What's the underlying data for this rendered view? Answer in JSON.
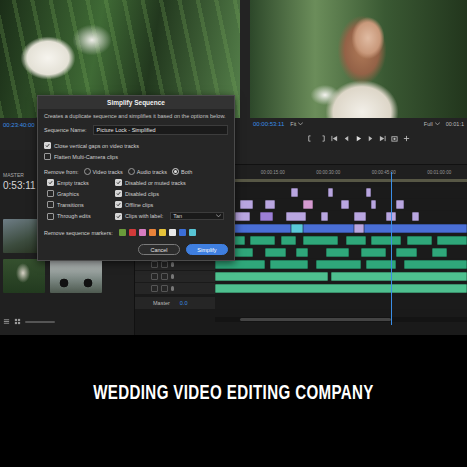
{
  "source_monitor": {
    "timecode": "00:23:40:00"
  },
  "program_monitor": {
    "timecode": "00:00:53:11",
    "fit": "Fit",
    "quality": "Full",
    "duration": "00:01:1"
  },
  "project_panel": {
    "label": "MASTER",
    "timecode": "0:53:11"
  },
  "timeline": {
    "ruler": [
      "00:00:15:00",
      "00:00:30:00",
      "00:00:45:00",
      "00:01:00:00"
    ],
    "playhead": {
      "level": 0.7
    },
    "tracks": [
      {
        "kind": "video",
        "clips": [
          {
            "start": 30,
            "length": 3,
            "color": "#b9a6e0"
          },
          {
            "start": 45,
            "length": 2,
            "color": "#b9a6e0"
          },
          {
            "start": 60,
            "length": 2,
            "color": "#b9a6e0"
          }
        ]
      },
      {
        "kind": "video",
        "clips": [
          {
            "start": 10,
            "length": 5,
            "color": "#b9a6e0"
          },
          {
            "start": 20,
            "length": 4,
            "color": "#b9a6e0"
          },
          {
            "start": 35,
            "length": 4,
            "color": "#d59ad0"
          },
          {
            "start": 50,
            "length": 3,
            "color": "#b9a6e0"
          },
          {
            "start": 62,
            "length": 2,
            "color": "#b9a6e0"
          },
          {
            "start": 72,
            "length": 3,
            "color": "#b9a6e0"
          }
        ]
      },
      {
        "kind": "video",
        "clips": [
          {
            "start": 8,
            "length": 6,
            "color": "#b9a6e0"
          },
          {
            "start": 18,
            "length": 5,
            "color": "#9c7fd6"
          },
          {
            "start": 28,
            "length": 8,
            "color": "#b9a6e0"
          },
          {
            "start": 42,
            "length": 3,
            "color": "#b9a6e0"
          },
          {
            "start": 55,
            "length": 5,
            "color": "#b9a6e0"
          },
          {
            "start": 68,
            "length": 4,
            "color": "#b9a6e0"
          },
          {
            "start": 78,
            "length": 3,
            "color": "#b9a6e0"
          }
        ]
      },
      {
        "kind": "video",
        "clips": [
          {
            "start": 0,
            "length": 30,
            "color": "#4a6fd6"
          },
          {
            "start": 30,
            "length": 5,
            "color": "#5ac8d8"
          },
          {
            "start": 35,
            "length": 20,
            "color": "#4a6fd6"
          },
          {
            "start": 55,
            "length": 4,
            "color": "#b9a6e0"
          },
          {
            "start": 59,
            "length": 41,
            "color": "#4a6fd6"
          }
        ]
      },
      {
        "kind": "audio",
        "clips": [
          {
            "start": 0,
            "length": 12,
            "color": "#2fa77a"
          },
          {
            "start": 14,
            "length": 10,
            "color": "#2fa77a"
          },
          {
            "start": 26,
            "length": 6,
            "color": "#2fa77a"
          },
          {
            "start": 35,
            "length": 14,
            "color": "#2fa77a"
          },
          {
            "start": 52,
            "length": 8,
            "color": "#2fa77a"
          },
          {
            "start": 62,
            "length": 12,
            "color": "#2fa77a"
          },
          {
            "start": 76,
            "length": 10,
            "color": "#2fa77a"
          },
          {
            "start": 88,
            "length": 12,
            "color": "#2fa77a"
          }
        ]
      },
      {
        "kind": "audio",
        "clips": [
          {
            "start": 5,
            "length": 10,
            "color": "#2fa77a"
          },
          {
            "start": 20,
            "length": 8,
            "color": "#2fa77a"
          },
          {
            "start": 32,
            "length": 5,
            "color": "#2fa77a"
          },
          {
            "start": 44,
            "length": 9,
            "color": "#2fa77a"
          },
          {
            "start": 58,
            "length": 10,
            "color": "#2fa77a"
          },
          {
            "start": 72,
            "length": 8,
            "color": "#2fa77a"
          },
          {
            "start": 86,
            "length": 6,
            "color": "#2fa77a"
          }
        ]
      },
      {
        "kind": "audio",
        "clips": [
          {
            "start": 0,
            "length": 20,
            "color": "#2fa77a"
          },
          {
            "start": 22,
            "length": 15,
            "color": "#2fa77a"
          },
          {
            "start": 40,
            "length": 18,
            "color": "#2fa77a"
          },
          {
            "start": 60,
            "length": 12,
            "color": "#2fa77a"
          },
          {
            "start": 75,
            "length": 25,
            "color": "#2fa77a"
          }
        ]
      },
      {
        "kind": "audio",
        "clips": [
          {
            "start": 0,
            "length": 45,
            "color": "#4ec08f"
          },
          {
            "start": 46,
            "length": 54,
            "color": "#4ec08f"
          }
        ]
      },
      {
        "kind": "audio",
        "clips": [
          {
            "start": 0,
            "length": 100,
            "color": "#4ec08f"
          }
        ]
      }
    ],
    "master": {
      "label": "Master",
      "value": "0.0"
    }
  },
  "dialog": {
    "title": "Simplify Sequence",
    "description": "Creates a duplicate sequence and simplifies it based on the options below.",
    "name_label": "Sequence Name:",
    "name_value": "Picture Lock - Simplified",
    "options": [
      {
        "label": "Close vertical gaps on video tracks",
        "checked": true
      },
      {
        "label": "Flatten Multi-Camera clips",
        "checked": false
      }
    ],
    "remove_from": {
      "label": "Remove from:",
      "choices": [
        {
          "label": "Video tracks",
          "selected": false
        },
        {
          "label": "Audio tracks",
          "selected": false
        },
        {
          "label": "Both",
          "selected": true
        }
      ]
    },
    "remove_items": [
      {
        "label": "Empty tracks",
        "checked": true
      },
      {
        "label": "Disabled or muted tracks",
        "checked": true
      },
      {
        "label": "Graphics",
        "checked": false
      },
      {
        "label": "Disabled clips",
        "checked": true
      },
      {
        "label": "Transitions",
        "checked": false
      },
      {
        "label": "Offline clips",
        "checked": true
      },
      {
        "label": "Through edits",
        "checked": false
      },
      {
        "label": "Clips with label:",
        "checked": true,
        "dropdown": "Tan"
      }
    ],
    "markers": {
      "label": "Remove sequence markers:",
      "colors": [
        {
          "color": "#6a9a3a"
        },
        {
          "color": "#d13a3a"
        },
        {
          "color": "#d77cc0"
        },
        {
          "color": "#e8833a"
        },
        {
          "color": "#e6c33a"
        },
        {
          "color": "#e8e8e8"
        },
        {
          "color": "#3b6fd8"
        },
        {
          "color": "#57c4d4"
        }
      ]
    },
    "buttons": [
      {
        "label": "Cancel",
        "primary": false
      },
      {
        "label": "Simplify",
        "primary": true
      }
    ]
  },
  "caption": "WEDDING VIDEO EDITING COMPANY"
}
